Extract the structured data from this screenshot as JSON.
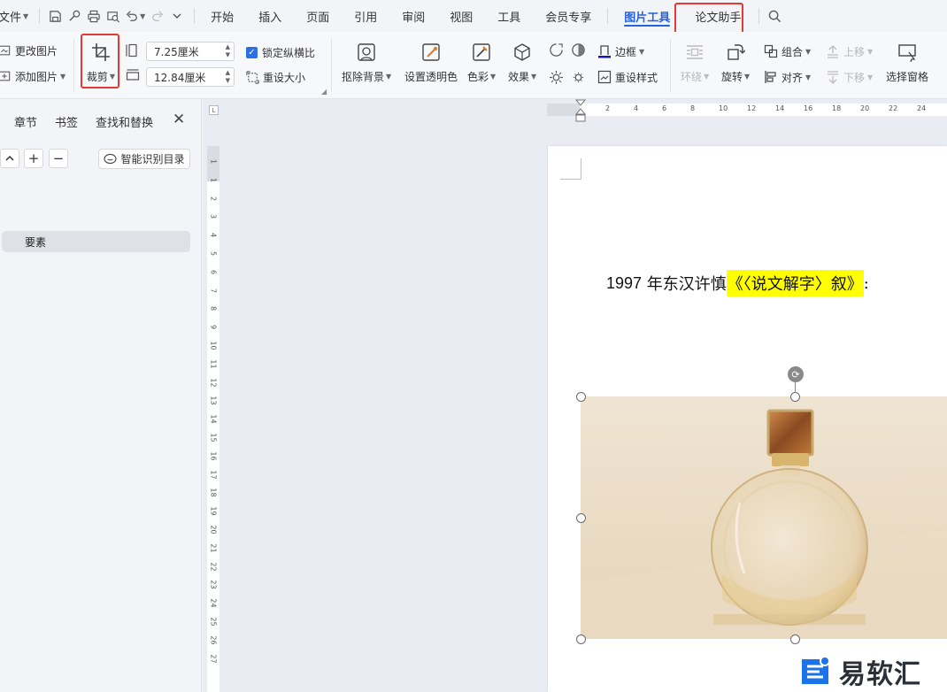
{
  "menubar": {
    "file_label": "文件",
    "tabs": [
      {
        "label": "开始"
      },
      {
        "label": "插入"
      },
      {
        "label": "页面"
      },
      {
        "label": "引用"
      },
      {
        "label": "审阅"
      },
      {
        "label": "视图"
      },
      {
        "label": "工具"
      },
      {
        "label": "会员专享"
      },
      {
        "label": "图片工具",
        "active": true
      },
      {
        "label": "论文助手"
      }
    ],
    "accent_color": "#2462e0",
    "highlight_color": "#e53935"
  },
  "ribbon": {
    "change_picture": "更改图片",
    "add_picture": "添加图片",
    "crop": "裁剪",
    "width_value": "7.25厘米",
    "height_value": "12.84厘米",
    "lock_ratio": "锁定纵横比",
    "reset_size": "重设大小",
    "remove_background": "抠除背景",
    "set_transparent": "设置透明色",
    "color": "色彩",
    "effects": "效果",
    "border": "边框",
    "reset_style": "重设样式",
    "wrap": "环绕",
    "rotate": "旋转",
    "group": "组合",
    "align": "对齐",
    "bring_forward": "上移",
    "send_backward": "下移",
    "selection_pane": "选择窗格"
  },
  "nav": {
    "tabs": [
      "章节",
      "书签",
      "查找和替换"
    ],
    "ai_toc": "智能识别目录",
    "items": [
      {
        "label": "要素"
      }
    ]
  },
  "ruler": {
    "horizontal_ticks": [
      "2",
      "4",
      "6",
      "8",
      "10",
      "12",
      "14",
      "16",
      "18",
      "20",
      "22",
      "24"
    ],
    "vertical_ticks": [
      "1",
      "1",
      "2",
      "3",
      "4",
      "5",
      "6",
      "7",
      "8",
      "9",
      "10",
      "11",
      "12",
      "13",
      "14",
      "15",
      "16",
      "17",
      "18",
      "19",
      "20",
      "21",
      "22",
      "23",
      "24",
      "25",
      "26",
      "27"
    ]
  },
  "document": {
    "line_year": "1997",
    "line_text": " 年东汉许慎",
    "line_highlight": "《〈说文解字〉叙》",
    "line_end": ":",
    "highlight_color": "#ffff00"
  },
  "watermark": {
    "text": "易软汇",
    "color": "#1a73e8"
  }
}
